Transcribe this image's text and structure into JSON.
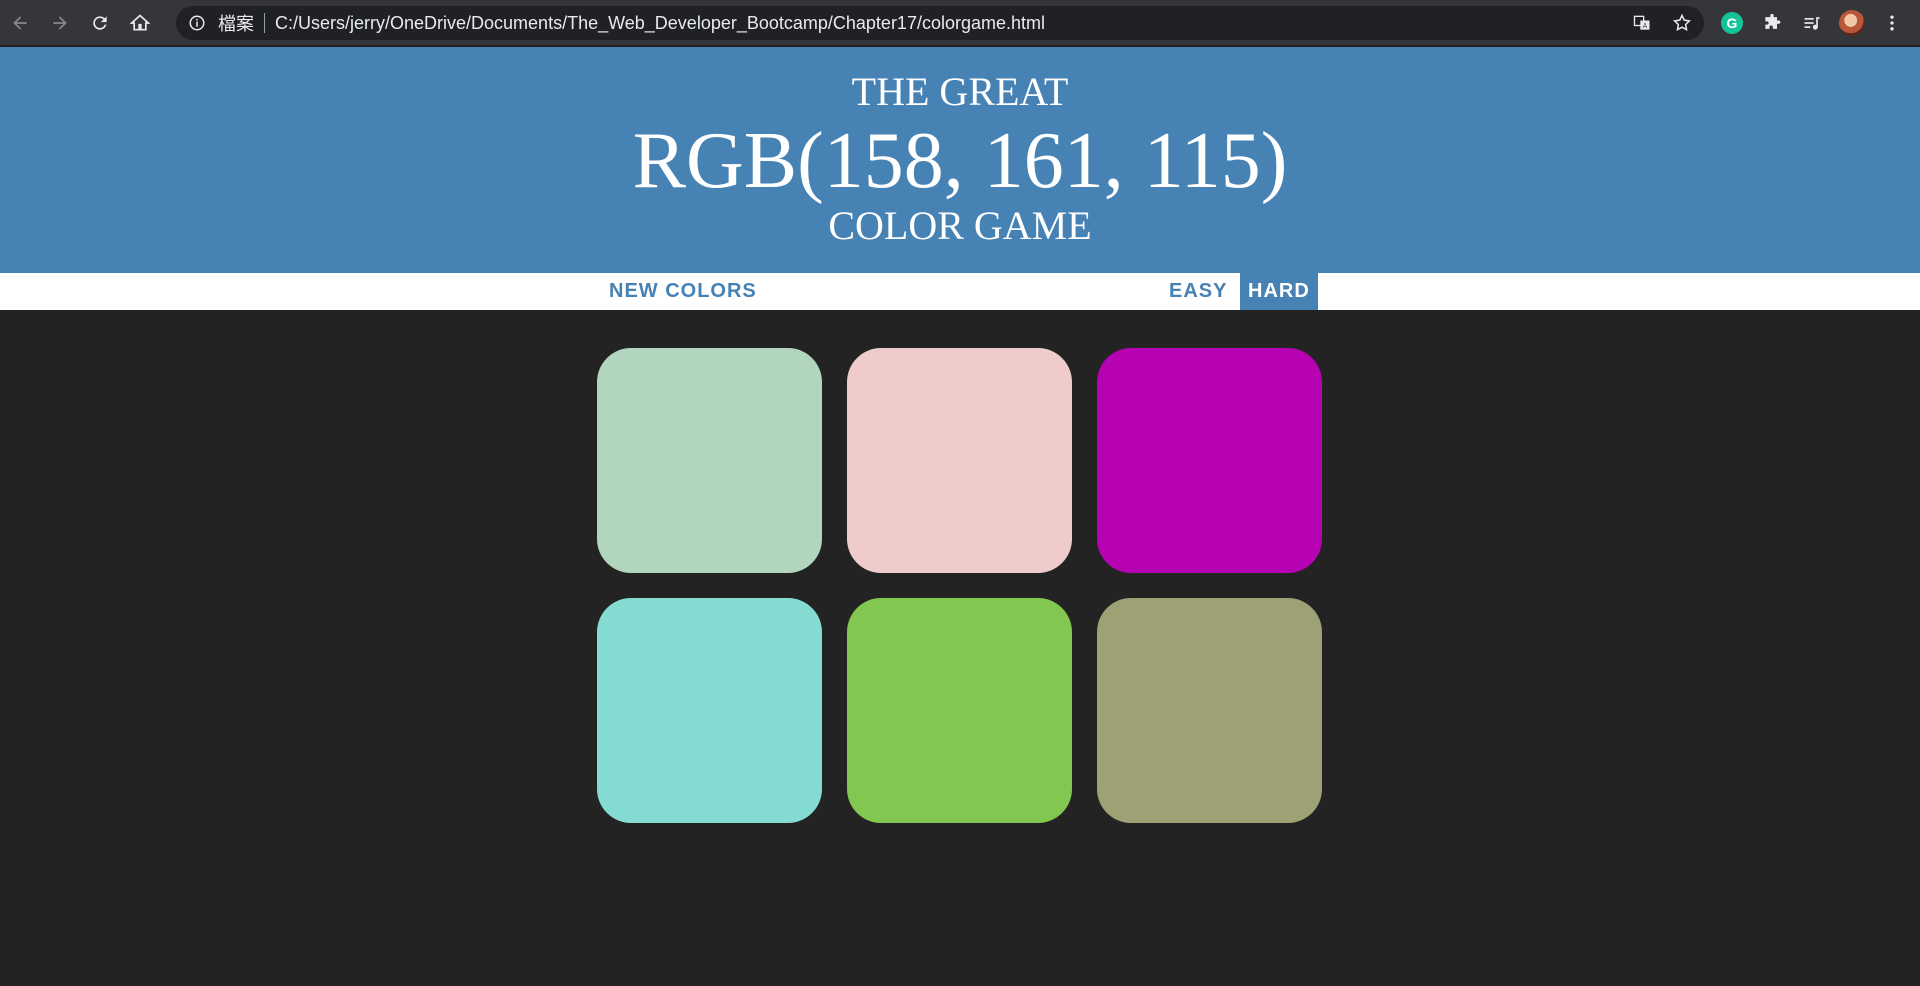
{
  "browser": {
    "file_label": "檔案",
    "url": "C:/Users/jerry/OneDrive/Documents/The_Web_Developer_Bootcamp/Chapter17/colorgame.html"
  },
  "header": {
    "line1": "THE GREAT",
    "rgb": "RGB(158, 161, 115)",
    "line3": "COLOR GAME"
  },
  "controls": {
    "reset_label": "NEW COLORS",
    "message": "",
    "easy_label": "EASY",
    "hard_label": "HARD",
    "selected_mode": "hard"
  },
  "colors": {
    "header_bg": "#4682b4",
    "body_bg": "#232323"
  },
  "squares": [
    {
      "color": "#b2d6bd"
    },
    {
      "color": "#f0cbcb"
    },
    {
      "color": "#b602b3"
    },
    {
      "color": "#84dbd2"
    },
    {
      "color": "#81c752"
    },
    {
      "color": "#9ea173"
    }
  ]
}
